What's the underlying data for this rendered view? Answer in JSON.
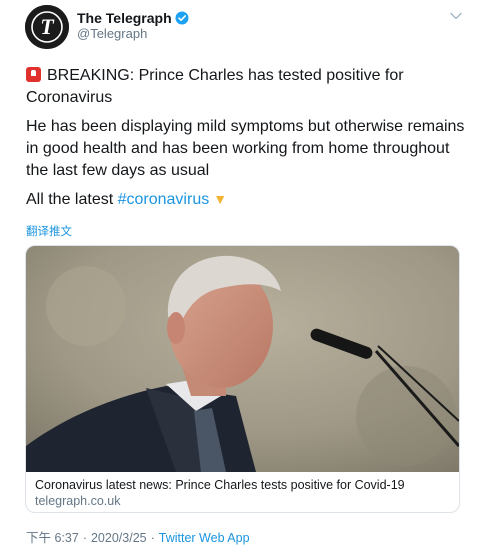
{
  "author": {
    "display_name": "The Telegraph",
    "handle": "@Telegraph",
    "verified": true
  },
  "tweet": {
    "breaking_line1": "BREAKING: Prince Charles has tested positive for",
    "breaking_line2": "Coronavirus",
    "para2_line1": "He has been displaying mild symptoms but otherwise remains",
    "para2_line2": "in good health and has been working from home throughout",
    "para2_line3": "the last few days as usual",
    "para3_text": "All the latest ",
    "hashtag": "#coronavirus",
    "emoji_icon": "backhand-index-pointing-down-icon"
  },
  "translate_label": "翻译推文",
  "card": {
    "title": "Coronavirus latest news: Prince Charles tests positive for Covid-19",
    "domain": "telegraph.co.uk"
  },
  "meta": {
    "time": "下午 6:37",
    "separator": "·",
    "date": "2020/3/25",
    "app": "Twitter Web App"
  },
  "colors": {
    "link": "#1b95e0",
    "text": "#14171a",
    "muted": "#657786",
    "verified": "#1da1f2",
    "siren": "#e0312c"
  }
}
